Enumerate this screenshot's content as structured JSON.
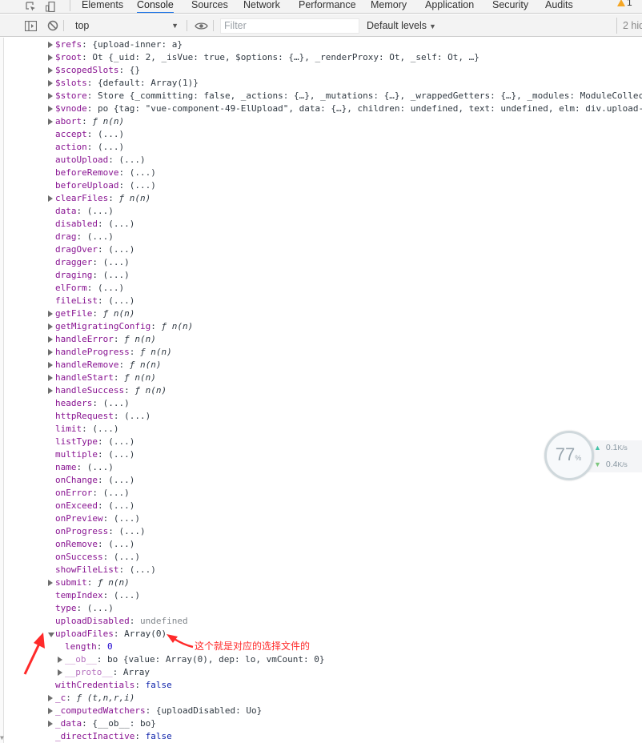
{
  "devtools_tabs": [
    {
      "label": "Elements",
      "active": false
    },
    {
      "label": "Console",
      "active": true
    },
    {
      "label": "Sources",
      "active": false
    },
    {
      "label": "Network",
      "active": false
    },
    {
      "label": "Performance",
      "active": false
    },
    {
      "label": "Memory",
      "active": false
    },
    {
      "label": "Application",
      "active": false
    },
    {
      "label": "Security",
      "active": false
    },
    {
      "label": "Audits",
      "active": false
    }
  ],
  "warnings_count": "1",
  "toolbar": {
    "context": "top",
    "filter_placeholder": "Filter",
    "levels": "Default levels",
    "hidden_count": "2 hid"
  },
  "console_rows": [
    {
      "tri": "r",
      "indent": 0,
      "name": "$refs",
      "value": "{upload-inner: a}"
    },
    {
      "tri": "r",
      "indent": 0,
      "name": "$root",
      "value": "Ot {_uid: 2, _isVue: true, $options: {…}, _renderProxy: Ot, _self: Ot, …}"
    },
    {
      "tri": "r",
      "indent": 0,
      "name": "$scopedSlots",
      "value": "{}"
    },
    {
      "tri": "r",
      "indent": 0,
      "name": "$slots",
      "value": "{default: Array(1)}"
    },
    {
      "tri": "r",
      "indent": 0,
      "name": "$store",
      "value": "Store {_committing: false, _actions: {…}, _mutations: {…}, _wrappedGetters: {…}, _modules: ModuleCollec"
    },
    {
      "tri": "r",
      "indent": 0,
      "name": "$vnode",
      "value": "po {tag: \"vue-component-49-ElUpload\", data: {…}, children: undefined, text: undefined, elm: div.upload-"
    },
    {
      "tri": "r",
      "indent": 0,
      "name": "abort",
      "value": "ƒ n(n)"
    },
    {
      "tri": "",
      "indent": 0,
      "name": "accept",
      "value": "(...)"
    },
    {
      "tri": "",
      "indent": 0,
      "name": "action",
      "value": "(...)"
    },
    {
      "tri": "",
      "indent": 0,
      "name": "autoUpload",
      "value": "(...)"
    },
    {
      "tri": "",
      "indent": 0,
      "name": "beforeRemove",
      "value": "(...)"
    },
    {
      "tri": "",
      "indent": 0,
      "name": "beforeUpload",
      "value": "(...)"
    },
    {
      "tri": "r",
      "indent": 0,
      "name": "clearFiles",
      "value": "ƒ n(n)"
    },
    {
      "tri": "",
      "indent": 0,
      "name": "data",
      "value": "(...)"
    },
    {
      "tri": "",
      "indent": 0,
      "name": "disabled",
      "value": "(...)"
    },
    {
      "tri": "",
      "indent": 0,
      "name": "drag",
      "value": "(...)"
    },
    {
      "tri": "",
      "indent": 0,
      "name": "dragOver",
      "value": "(...)"
    },
    {
      "tri": "",
      "indent": 0,
      "name": "dragger",
      "value": "(...)"
    },
    {
      "tri": "",
      "indent": 0,
      "name": "draging",
      "value": "(...)"
    },
    {
      "tri": "",
      "indent": 0,
      "name": "elForm",
      "value": "(...)"
    },
    {
      "tri": "",
      "indent": 0,
      "name": "fileList",
      "value": "(...)"
    },
    {
      "tri": "r",
      "indent": 0,
      "name": "getFile",
      "value": "ƒ n(n)"
    },
    {
      "tri": "r",
      "indent": 0,
      "name": "getMigratingConfig",
      "value": "ƒ n(n)"
    },
    {
      "tri": "r",
      "indent": 0,
      "name": "handleError",
      "value": "ƒ n(n)"
    },
    {
      "tri": "r",
      "indent": 0,
      "name": "handleProgress",
      "value": "ƒ n(n)"
    },
    {
      "tri": "r",
      "indent": 0,
      "name": "handleRemove",
      "value": "ƒ n(n)"
    },
    {
      "tri": "r",
      "indent": 0,
      "name": "handleStart",
      "value": "ƒ n(n)"
    },
    {
      "tri": "r",
      "indent": 0,
      "name": "handleSuccess",
      "value": "ƒ n(n)"
    },
    {
      "tri": "",
      "indent": 0,
      "name": "headers",
      "value": "(...)"
    },
    {
      "tri": "",
      "indent": 0,
      "name": "httpRequest",
      "value": "(...)"
    },
    {
      "tri": "",
      "indent": 0,
      "name": "limit",
      "value": "(...)"
    },
    {
      "tri": "",
      "indent": 0,
      "name": "listType",
      "value": "(...)"
    },
    {
      "tri": "",
      "indent": 0,
      "name": "multiple",
      "value": "(...)"
    },
    {
      "tri": "",
      "indent": 0,
      "name": "name",
      "value": "(...)"
    },
    {
      "tri": "",
      "indent": 0,
      "name": "onChange",
      "value": "(...)"
    },
    {
      "tri": "",
      "indent": 0,
      "name": "onError",
      "value": "(...)"
    },
    {
      "tri": "",
      "indent": 0,
      "name": "onExceed",
      "value": "(...)"
    },
    {
      "tri": "",
      "indent": 0,
      "name": "onPreview",
      "value": "(...)"
    },
    {
      "tri": "",
      "indent": 0,
      "name": "onProgress",
      "value": "(...)"
    },
    {
      "tri": "",
      "indent": 0,
      "name": "onRemove",
      "value": "(...)"
    },
    {
      "tri": "",
      "indent": 0,
      "name": "onSuccess",
      "value": "(...)"
    },
    {
      "tri": "",
      "indent": 0,
      "name": "showFileList",
      "value": "(...)"
    },
    {
      "tri": "r",
      "indent": 0,
      "name": "submit",
      "value": "ƒ n(n)"
    },
    {
      "tri": "",
      "indent": 0,
      "name": "tempIndex",
      "value": "(...)"
    },
    {
      "tri": "",
      "indent": 0,
      "name": "type",
      "value": "(...)"
    },
    {
      "tri": "",
      "indent": 0,
      "name": "uploadDisabled",
      "value": "undefined"
    },
    {
      "tri": "d",
      "indent": 0,
      "name": "uploadFiles",
      "value": "Array(0)"
    },
    {
      "tri": "",
      "indent": 1,
      "name": "length",
      "value": "0"
    },
    {
      "tri": "r",
      "indent": 1,
      "name": "__ob__",
      "value": "bo {value: Array(0), dep: lo, vmCount: 0}"
    },
    {
      "tri": "r",
      "indent": 1,
      "name": "__proto__",
      "value": "Array"
    },
    {
      "tri": "",
      "indent": 0,
      "name": "withCredentials",
      "value": "false"
    },
    {
      "tri": "r",
      "indent": 0,
      "name": "_c",
      "value": "ƒ (t,n,r,i)"
    },
    {
      "tri": "r",
      "indent": 0,
      "name": "_computedWatchers",
      "value": "{uploadDisabled: Uo}"
    },
    {
      "tri": "r",
      "indent": 0,
      "name": "_data",
      "value": "{__ob__: bo}"
    },
    {
      "tri": "",
      "indent": 0,
      "name": "_directInactive",
      "value": "false"
    }
  ],
  "perf_widget": {
    "percent": "77",
    "percent_unit": "%",
    "upload": "0.1",
    "download": "0.4",
    "rate_unit": "K/s"
  },
  "annotation": "这个就是对应的选择文件的",
  "colors": {
    "annotation": "#ff2a2a",
    "prop_name": "#881391",
    "active_tab": "#1a73e8"
  }
}
